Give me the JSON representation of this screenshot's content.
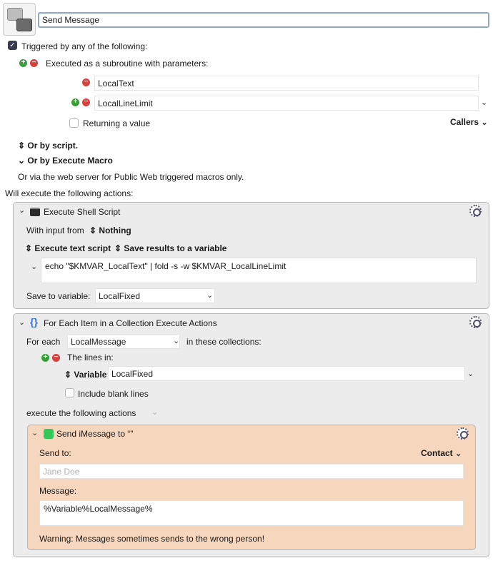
{
  "macro": {
    "name": "Send Message"
  },
  "trigger": {
    "header": "Triggered by any of the following:",
    "subroutine_label": "Executed as a subroutine with parameters:",
    "params": [
      "LocalText",
      "LocalLineLimit"
    ],
    "returning_label": "Returning a value",
    "callers_label": "Callers",
    "or_by_script": "Or by script.",
    "or_by_execute_macro": "Or by Execute Macro",
    "web_server_note": "Or via the web server for Public Web triggered macros only."
  },
  "actions_header": "Will execute the following actions:",
  "shell_action": {
    "title": "Execute Shell Script",
    "with_input_label": "With input from",
    "with_input_value": "Nothing",
    "execute_mode": "Execute text script",
    "save_mode": "Save results to a variable",
    "script": "echo \"$KMVAR_LocalText\" | fold -s -w $KMVAR_LocalLineLimit",
    "save_to_label": "Save to variable:",
    "save_to_value": "LocalFixed"
  },
  "foreach_action": {
    "title": "For Each Item in a Collection Execute Actions",
    "for_each_label": "For each",
    "for_each_var": "LocalMessage",
    "in_collections_label": "in these collections:",
    "lines_in_label": "The lines in:",
    "variable_label": "Variable",
    "variable_value": "LocalFixed",
    "include_blank_label": "Include blank lines",
    "execute_following": "execute the following actions"
  },
  "imessage_action": {
    "title": "Send iMessage to “”",
    "send_to_label": "Send to:",
    "contact_label": "Contact",
    "send_to_placeholder": "Jane Doe",
    "message_label": "Message:",
    "message_value": "%Variable%LocalMessage%",
    "warning": "Warning: Messages sometimes sends to the wrong person!"
  }
}
